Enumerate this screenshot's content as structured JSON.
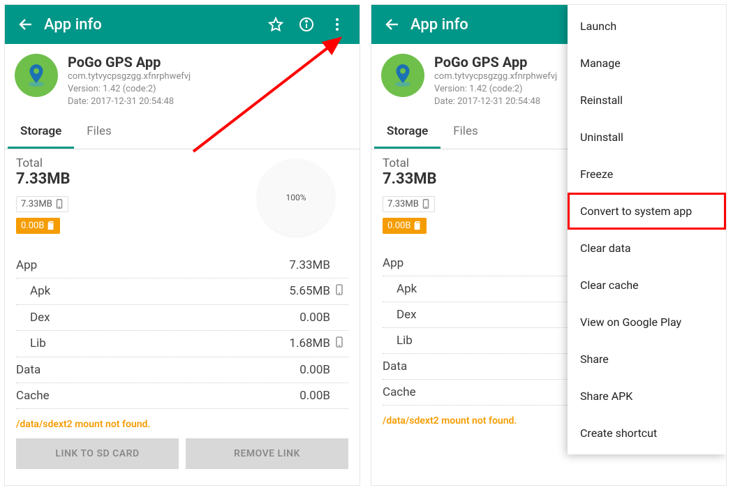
{
  "appbar": {
    "title": "App info"
  },
  "app": {
    "name": "PoGo GPS App",
    "package": "com.tytvycpsgzgg.xfnrphwefvj",
    "version": "Version: 1.42 (code:2)",
    "date": "Date: 2017-12-31 20:54:48"
  },
  "tabs": {
    "storage": "Storage",
    "files": "Files"
  },
  "storage": {
    "totalLabel": "Total",
    "totalValue": "7.33MB",
    "chipPhone": "7.33MB",
    "chipSd": "0.00B",
    "piePct": "100%",
    "rows": {
      "app": {
        "label": "App",
        "value": "7.33MB"
      },
      "apk": {
        "label": "Apk",
        "value": "5.65MB"
      },
      "dex": {
        "label": "Dex",
        "value": "0.00B"
      },
      "lib": {
        "label": "Lib",
        "value": "1.68MB"
      },
      "data": {
        "label": "Data",
        "value": "0.00B"
      },
      "cache": {
        "label": "Cache",
        "value": "0.00B"
      }
    },
    "warning": "/data/sdext2 mount not found.",
    "btnLink": "LINK TO SD CARD",
    "btnRemove": "REMOVE LINK"
  },
  "menu": {
    "launch": "Launch",
    "manage": "Manage",
    "reinstall": "Reinstall",
    "uninstall": "Uninstall",
    "freeze": "Freeze",
    "convert": "Convert to system app",
    "clearData": "Clear data",
    "clearCache": "Clear cache",
    "viewPlay": "View on Google Play",
    "share": "Share",
    "shareApk": "Share APK",
    "shortcut": "Create shortcut"
  }
}
